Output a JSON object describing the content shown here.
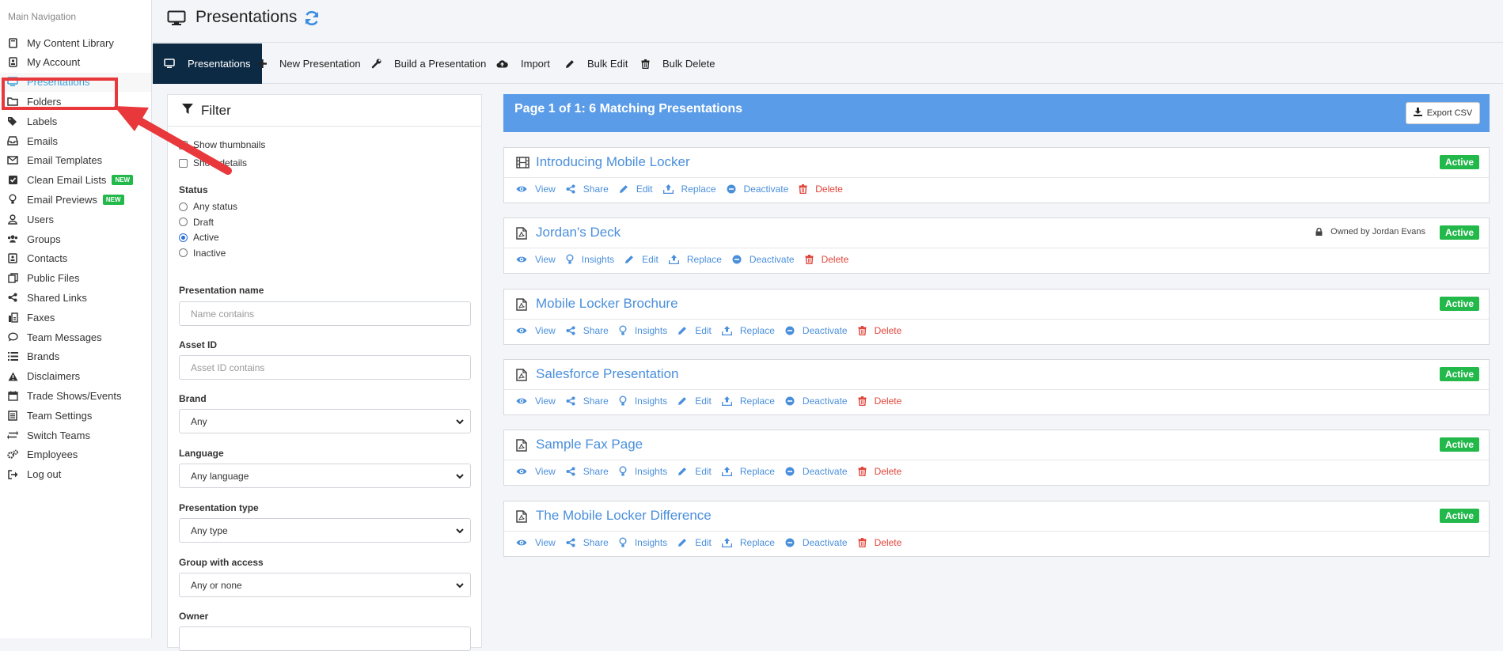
{
  "sidebar": {
    "title": "Main Navigation",
    "items": [
      {
        "label": "My Content Library",
        "icon": "book-icon"
      },
      {
        "label": "My Account",
        "icon": "id-card-icon"
      },
      {
        "label": "Presentations",
        "icon": "monitor-icon",
        "active": true
      },
      {
        "label": "Folders",
        "icon": "folder-icon"
      },
      {
        "label": "Labels",
        "icon": "tags-icon"
      },
      {
        "label": "Emails",
        "icon": "inbox-icon"
      },
      {
        "label": "Email Templates",
        "icon": "envelope-icon"
      },
      {
        "label": "Clean Email Lists",
        "icon": "check-square-icon",
        "badge": "NEW"
      },
      {
        "label": "Email Previews",
        "icon": "lightbulb-icon",
        "badge": "NEW"
      },
      {
        "label": "Users",
        "icon": "user-icon"
      },
      {
        "label": "Groups",
        "icon": "users-icon"
      },
      {
        "label": "Contacts",
        "icon": "address-book-icon"
      },
      {
        "label": "Public Files",
        "icon": "copy-icon"
      },
      {
        "label": "Shared Links",
        "icon": "share-icon"
      },
      {
        "label": "Faxes",
        "icon": "fax-icon"
      },
      {
        "label": "Team Messages",
        "icon": "comment-icon"
      },
      {
        "label": "Brands",
        "icon": "list-icon"
      },
      {
        "label": "Disclaimers",
        "icon": "warning-icon"
      },
      {
        "label": "Trade Shows/Events",
        "icon": "calendar-icon"
      },
      {
        "label": "Team Settings",
        "icon": "settings-doc-icon"
      },
      {
        "label": "Switch Teams",
        "icon": "exchange-icon"
      },
      {
        "label": "Employees",
        "icon": "cogs-icon"
      },
      {
        "label": "Log out",
        "icon": "sign-out-icon"
      }
    ]
  },
  "header": {
    "title": "Presentations"
  },
  "toolbar": {
    "items": [
      {
        "label": "Presentations",
        "icon": "monitor-icon",
        "active": true
      },
      {
        "label": "New Presentation",
        "icon": "plus-icon"
      },
      {
        "label": "Build a Presentation",
        "icon": "wrench-icon"
      },
      {
        "label": "Import",
        "icon": "cloud-upload-icon"
      },
      {
        "label": "Bulk Edit",
        "icon": "pencil-icon"
      },
      {
        "label": "Bulk Delete",
        "icon": "trash-icon"
      }
    ]
  },
  "filter": {
    "title": "Filter",
    "show_thumbnails": "Show thumbnails",
    "show_details": "Show details",
    "status_label": "Status",
    "status_options": [
      "Any status",
      "Draft",
      "Active",
      "Inactive"
    ],
    "status_selected": "Active",
    "name_label": "Presentation name",
    "name_placeholder": "Name contains",
    "asset_label": "Asset ID",
    "asset_placeholder": "Asset ID contains",
    "brand_label": "Brand",
    "brand_value": "Any",
    "language_label": "Language",
    "language_value": "Any language",
    "type_label": "Presentation type",
    "type_value": "Any type",
    "group_label": "Group with access",
    "group_value": "Any or none",
    "owner_label": "Owner"
  },
  "results": {
    "summary": "Page 1 of 1: 6 Matching Presentations",
    "export_label": "Export CSV",
    "presentations": [
      {
        "title": "Introducing Mobile Locker",
        "icon": "film-icon",
        "status": "Active",
        "owner": "",
        "actions": [
          "View",
          "Share",
          "Edit",
          "Replace",
          "Deactivate",
          "Delete"
        ]
      },
      {
        "title": "Jordan's Deck",
        "icon": "pdf-file-icon",
        "status": "Active",
        "owner": "Owned by Jordan Evans",
        "actions": [
          "View",
          "Insights",
          "Edit",
          "Replace",
          "Deactivate",
          "Delete"
        ]
      },
      {
        "title": "Mobile Locker Brochure",
        "icon": "pdf-file-icon",
        "status": "Active",
        "owner": "",
        "actions": [
          "View",
          "Share",
          "Insights",
          "Edit",
          "Replace",
          "Deactivate",
          "Delete"
        ]
      },
      {
        "title": "Salesforce Presentation",
        "icon": "pdf-file-icon",
        "status": "Active",
        "owner": "",
        "actions": [
          "View",
          "Share",
          "Insights",
          "Edit",
          "Replace",
          "Deactivate",
          "Delete"
        ]
      },
      {
        "title": "Sample Fax Page",
        "icon": "pdf-file-icon",
        "status": "Active",
        "owner": "",
        "actions": [
          "View",
          "Share",
          "Insights",
          "Edit",
          "Replace",
          "Deactivate",
          "Delete"
        ]
      },
      {
        "title": "The Mobile Locker Difference",
        "icon": "pdf-file-icon",
        "status": "Active",
        "owner": "",
        "actions": [
          "View",
          "Share",
          "Insights",
          "Edit",
          "Replace",
          "Deactivate",
          "Delete"
        ]
      }
    ]
  },
  "colors": {
    "accent": "#4a8fdb",
    "toolbar_active": "#0d2a44",
    "status_active": "#22b84a",
    "delete": "#e0453a",
    "highlight": "#e8383c"
  }
}
